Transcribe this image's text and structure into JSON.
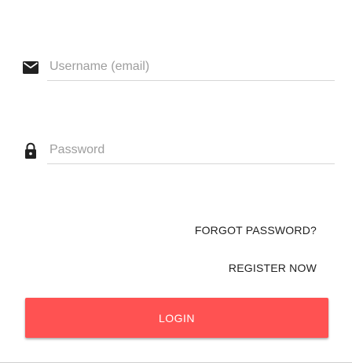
{
  "form": {
    "username": {
      "placeholder": "Username (email)",
      "value": "",
      "icon": "email-icon"
    },
    "password": {
      "placeholder": "Password",
      "value": "",
      "icon": "lock-icon"
    },
    "forgot_password_label": "FORGOT PASSWORD?",
    "register_label": "REGISTER NOW",
    "login_label": "LOGIN"
  },
  "colors": {
    "accent": "#ff5252",
    "icon": "#212121",
    "placeholder": "#9e9e9e",
    "link_text": "#212121"
  }
}
